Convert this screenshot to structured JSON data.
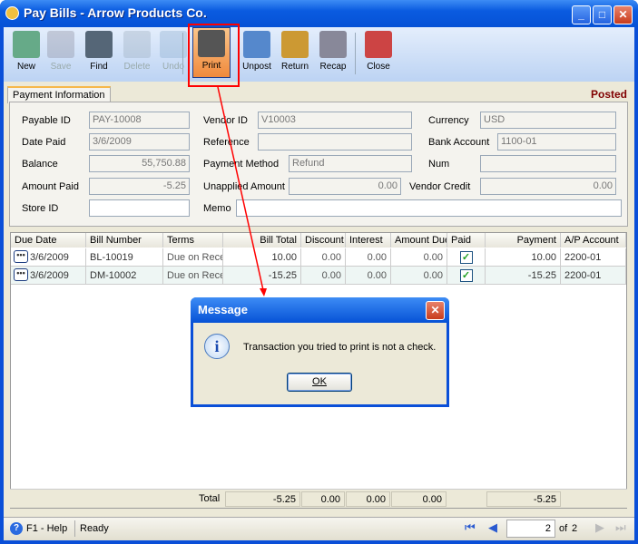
{
  "window": {
    "title": "Pay Bills - Arrow Products Co."
  },
  "toolbar": [
    {
      "label": "New",
      "enabled": true,
      "icon": "new-icon"
    },
    {
      "label": "Save",
      "enabled": false,
      "icon": "save-icon"
    },
    {
      "label": "Find",
      "enabled": true,
      "icon": "binoculars-icon"
    },
    {
      "label": "Delete",
      "enabled": false,
      "icon": "recycle-bin-icon"
    },
    {
      "label": "Undo",
      "enabled": false,
      "icon": "undo-icon"
    },
    {
      "label": "Print",
      "enabled": true,
      "active": true,
      "icon": "printer-icon"
    },
    {
      "label": "Unpost",
      "enabled": true,
      "icon": "unpost-icon"
    },
    {
      "label": "Return",
      "enabled": true,
      "icon": "return-icon"
    },
    {
      "label": "Recap",
      "enabled": true,
      "icon": "recap-icon"
    },
    {
      "label": "Close",
      "enabled": true,
      "icon": "close-form-icon"
    }
  ],
  "tab": "Payment Information",
  "status_badge": "Posted",
  "form": {
    "payable_id": {
      "label": "Payable ID",
      "value": "PAY-10008"
    },
    "date_paid": {
      "label": "Date Paid",
      "value": "3/6/2009"
    },
    "balance": {
      "label": "Balance",
      "value": "55,750.88"
    },
    "amount_paid": {
      "label": "Amount Paid",
      "value": "-5.25"
    },
    "store_id": {
      "label": "Store ID",
      "value": ""
    },
    "vendor_id": {
      "label": "Vendor ID",
      "value": "V10003"
    },
    "reference": {
      "label": "Reference",
      "value": ""
    },
    "payment_method": {
      "label": "Payment Method",
      "value": "Refund"
    },
    "unapplied_amount": {
      "label": "Unapplied Amount",
      "value": "0.00"
    },
    "memo": {
      "label": "Memo",
      "value": ""
    },
    "currency": {
      "label": "Currency",
      "value": "USD"
    },
    "bank_account": {
      "label": "Bank Account",
      "value": "1100-01"
    },
    "num": {
      "label": "Num",
      "value": ""
    },
    "vendor_credit": {
      "label": "Vendor Credit",
      "value": "0.00"
    }
  },
  "grid": {
    "columns": [
      "Due Date",
      "Bill Number",
      "Terms",
      "Bill Total",
      "Discount",
      "Interest",
      "Amount Due",
      "Paid",
      "Payment",
      "A/P Account"
    ],
    "rows": [
      [
        "3/6/2009",
        "BL-10019",
        "Due on Rece",
        "10.00",
        "0.00",
        "0.00",
        "0.00",
        true,
        "10.00",
        "2200-01"
      ],
      [
        "3/6/2009",
        "DM-10002",
        "Due on Rece",
        "-15.25",
        "0.00",
        "0.00",
        "0.00",
        true,
        "-15.25",
        "2200-01"
      ]
    ],
    "totals": {
      "label": "Total",
      "bill_total": "-5.25",
      "discount": "0.00",
      "interest": "0.00",
      "amount_due": "0.00",
      "payment": "-5.25"
    }
  },
  "statusbar": {
    "help": "F1 - Help",
    "status": "Ready",
    "page": "2",
    "of_label": "of",
    "total_pages": "2"
  },
  "dialog": {
    "title": "Message",
    "message": "Transaction you tried to print is not a check.",
    "ok": "OK",
    "icon": "info-icon"
  },
  "colors": {
    "titlebar": "#0652d6",
    "annotation": "#ff0000",
    "posted": "#800000"
  }
}
